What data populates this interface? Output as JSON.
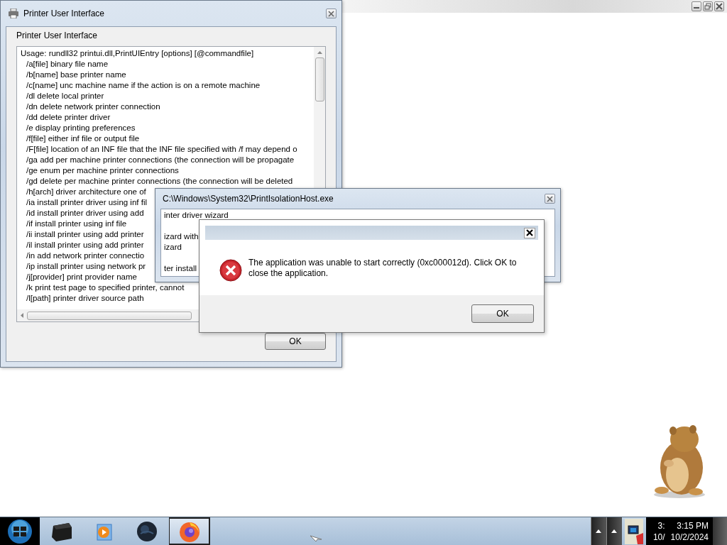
{
  "printer_window": {
    "title": "Printer User Interface",
    "heading": "Printer User Interface",
    "usage": "Usage: rundll32 printui.dll,PrintUIEntry [options] [@commandfile]",
    "options": [
      "/a[file] binary file name",
      "/b[name] base printer name",
      "/c[name] unc machine name if the action is on a remote machine",
      "/dl delete local printer",
      "/dn delete network printer connection",
      "/dd delete printer driver",
      "/e display printing preferences",
      "/f[file] either inf file or output file",
      "/F[file] location of an INF file that the INF file specified with /f may depend o",
      "/ga add per machine printer connections (the connection will be propagate",
      "/ge enum per machine printer connections",
      "/gd delete per machine printer connections (the connection will be deleted",
      "/h[arch] driver architecture one of",
      "/ia install printer driver using inf fil",
      "/id install printer driver using add",
      "/if install printer using inf file",
      "/ii install printer using add printer",
      "/il install printer using add printer",
      "/in add network printer connectio",
      "/ip install printer using network pr",
      "/j[provider] print provider name",
      "/k print test page to specified printer, cannot",
      "/l[path] printer driver source path"
    ],
    "button": "OK"
  },
  "host_window": {
    "title": "C:\\Windows\\System32\\PrintIsolationHost.exe",
    "lines": [
      "inter driver wizard",
      "izard with",
      "izard",
      "ter install"
    ]
  },
  "error_dialog": {
    "message": "The application was unable to start correctly (0xc000012d). Click OK to close the application.",
    "button": "OK"
  },
  "taskbar": {
    "apps": [
      {
        "kind": "printer",
        "selected": false
      },
      {
        "kind": "media",
        "selected": false
      },
      {
        "kind": "globe",
        "selected": false
      },
      {
        "kind": "browser",
        "selected": true
      }
    ],
    "clock": {
      "ghost_time": "3:",
      "ghost_date": "10/",
      "time": "3:15 PM",
      "date": "10/2/2024"
    }
  }
}
